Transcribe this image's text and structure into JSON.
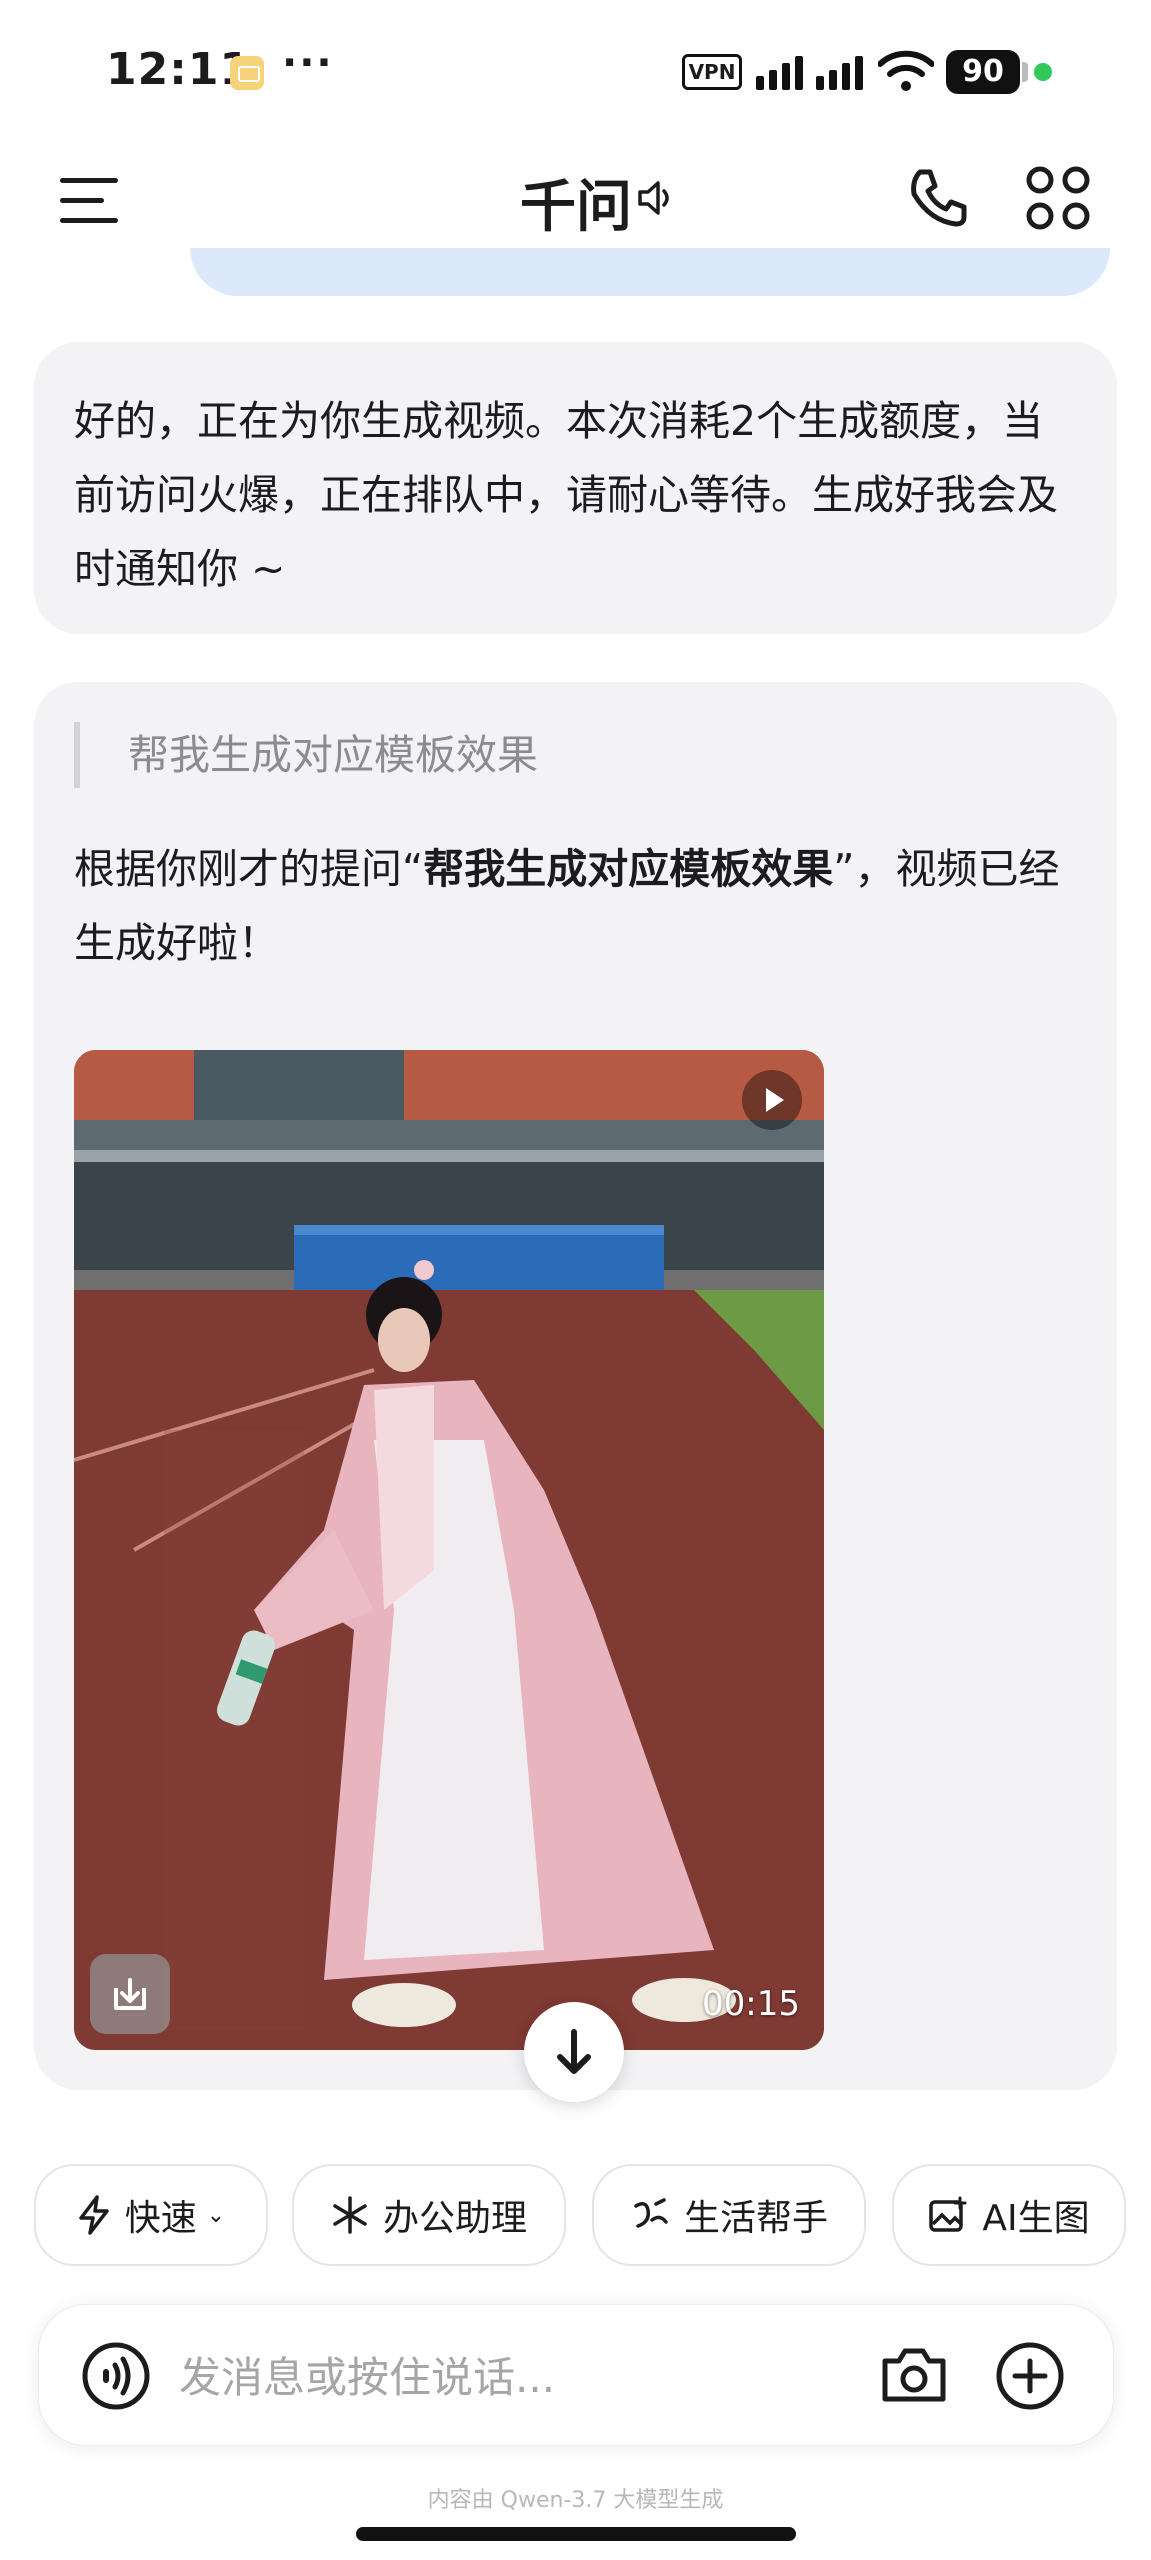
{
  "status_bar": {
    "time": "12:11",
    "more": "···",
    "vpn": "VPN",
    "battery": "90"
  },
  "header": {
    "title": "千问"
  },
  "messages": {
    "reply1": "好的，正在为你生成视频。本次消耗2个生成额度，当前访问火爆，正在排队中，请耐心等待。生成好我会及时通知你 ~",
    "quote": "帮我生成对应模板效果",
    "reply2_prefix": "根据你刚才的提问“",
    "reply2_bold": "帮我生成对应模板效果",
    "reply2_suffix": "”，视频已经生成好啦！",
    "video_duration": "00:15"
  },
  "tools": {
    "fast": "快速",
    "office": "办公助理",
    "life": "生活帮手",
    "ai_image": "AI生图"
  },
  "input": {
    "placeholder": "发消息或按住说话..."
  },
  "footer": {
    "note": "内容由 Qwen-3.7 大模型生成"
  },
  "colors": {
    "accent_bubble": "#dbe9fb",
    "card_bg": "#f3f3f5",
    "status_green": "#34c759"
  },
  "icons": [
    "menu-icon",
    "speaker-icon",
    "phone-icon",
    "apps-icon",
    "play-icon",
    "download-icon",
    "arrow-down-icon",
    "lightning-icon",
    "sparkle-icon",
    "assistant-icon",
    "image-plus-icon",
    "voice-icon",
    "camera-icon",
    "plus-icon"
  ]
}
